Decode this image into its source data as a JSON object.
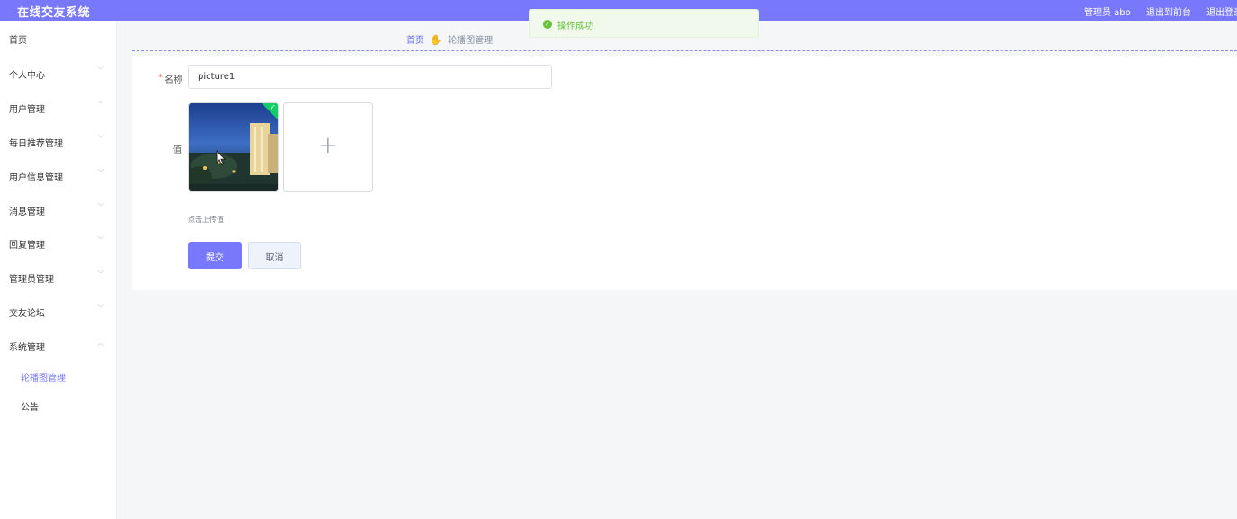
{
  "app": {
    "title": "在线交友系统"
  },
  "header": {
    "admin_label": "管理员 abo",
    "frontend_link": "退出到前台",
    "logout_link": "退出登录"
  },
  "sidebar": {
    "items": [
      {
        "label": "首页",
        "expandable": false
      },
      {
        "label": "个人中心",
        "expandable": true
      },
      {
        "label": "用户管理",
        "expandable": true
      },
      {
        "label": "每日推荐管理",
        "expandable": true
      },
      {
        "label": "用户信息管理",
        "expandable": true
      },
      {
        "label": "消息管理",
        "expandable": true
      },
      {
        "label": "回复管理",
        "expandable": true
      },
      {
        "label": "管理员管理",
        "expandable": true
      },
      {
        "label": "交友论坛",
        "expandable": true
      },
      {
        "label": "系统管理",
        "expandable": true,
        "expanded": true
      }
    ],
    "sub_items": [
      {
        "label": "轮播图管理",
        "active": true
      },
      {
        "label": "公告",
        "active": false
      }
    ]
  },
  "breadcrumb": {
    "home": "首页",
    "current": "轮播图管理"
  },
  "form": {
    "name_label": "名称",
    "name_value": "picture1",
    "value_label": "值",
    "upload_hint": "点击上传值",
    "submit_label": "提交",
    "cancel_label": "取消"
  },
  "toast": {
    "message": "操作成功"
  },
  "colors": {
    "primary": "#7878fd",
    "success": "#67c23a",
    "required": "#f56c6c"
  },
  "icons": {
    "success": "check-circle-icon",
    "upload": "plus-icon",
    "breadcrumb_separator": "hand-icon",
    "chevron": "chevron-down-icon"
  }
}
